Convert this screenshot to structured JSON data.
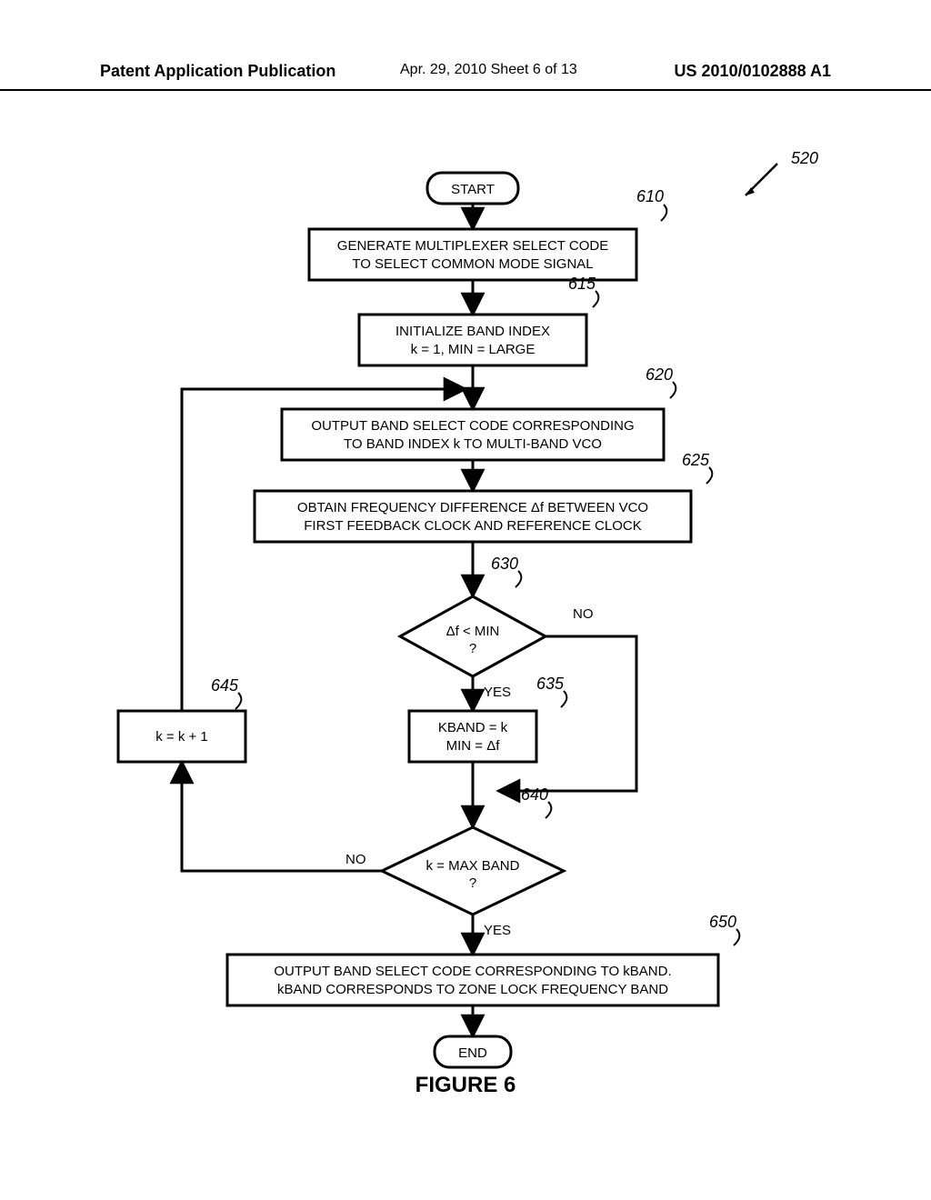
{
  "header": {
    "left": "Patent Application Publication",
    "mid": "Apr. 29, 2010  Sheet 6 of 13",
    "right": "US 2010/0102888 A1"
  },
  "figure_caption": "FIGURE 6",
  "ref_main": "520",
  "nodes": {
    "start": "START",
    "end": "END",
    "n610_l1": "GENERATE MULTIPLEXER SELECT CODE",
    "n610_l2": "TO SELECT COMMON MODE SIGNAL",
    "n615_l1": "INITIALIZE BAND INDEX",
    "n615_l2": "k = 1, MIN = LARGE",
    "n620_l1": "OUTPUT BAND SELECT CODE CORRESPONDING",
    "n620_l2": "TO BAND INDEX k TO MULTI-BAND VCO",
    "n625_l1": "OBTAIN FREQUENCY DIFFERENCE Δf BETWEEN VCO",
    "n625_l2": "FIRST FEEDBACK CLOCK AND REFERENCE CLOCK",
    "n630_l1": "Δf < MIN",
    "n630_l2": "?",
    "n635_l1": "KBAND = k",
    "n635_l2": "MIN = Δf",
    "n640_l1": "k = MAX BAND",
    "n640_l2": "?",
    "n645": "k = k + 1",
    "n650_l1": "OUTPUT BAND SELECT CODE CORRESPONDING TO kBAND.",
    "n650_l2": "kBAND CORRESPONDS TO ZONE LOCK FREQUENCY BAND"
  },
  "refs": {
    "r610": "610",
    "r615": "615",
    "r620": "620",
    "r625": "625",
    "r630": "630",
    "r635": "635",
    "r640": "640",
    "r645": "645",
    "r650": "650"
  },
  "edges": {
    "yes": "YES",
    "no": "NO"
  }
}
